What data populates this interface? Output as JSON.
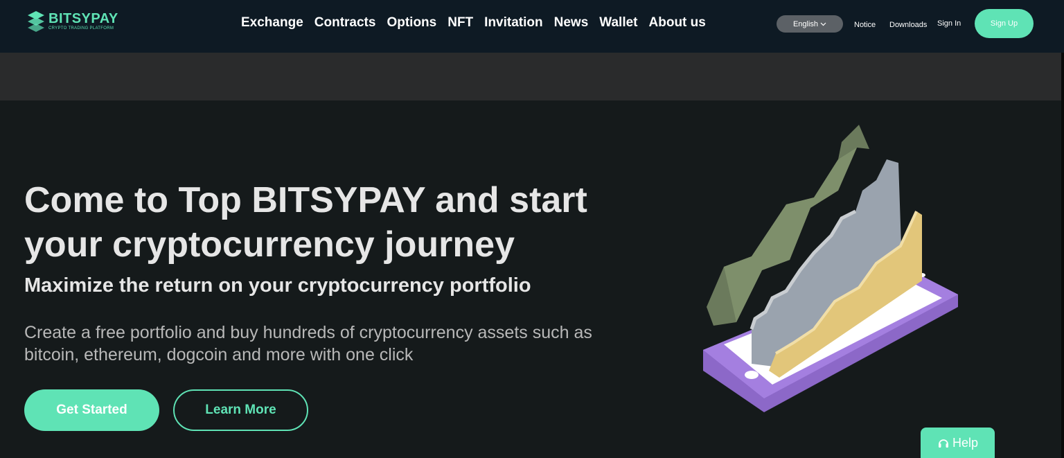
{
  "brand": {
    "name": "BITSYPAY",
    "tagline": "CRYPTO TRADING PLATFORM",
    "accent_color": "#5fe3b5"
  },
  "nav": {
    "items": [
      {
        "label": "Exchange"
      },
      {
        "label": "Contracts"
      },
      {
        "label": "Options"
      },
      {
        "label": "NFT"
      },
      {
        "label": "Invitation"
      },
      {
        "label": "News"
      },
      {
        "label": "Wallet"
      },
      {
        "label": "About us"
      }
    ]
  },
  "header_right": {
    "language": "English",
    "notice": "Notice",
    "downloads": "Downloads",
    "sign_in": "Sign In",
    "sign_up": "Sign Up"
  },
  "hero": {
    "title": "Come to Top BITSYPAY and start your cryptocurrency journey",
    "subtitle": "Maximize the return on your cryptocurrency portfolio",
    "description": "Create a free portfolio and buy hundreds of cryptocurrency assets such as bitcoin, ethereum, dogcoin and more with one click",
    "primary_button": "Get Started",
    "secondary_button": "Learn More",
    "illustration_icon": "phone-growth-chart-illustration"
  },
  "help": {
    "label": "Help",
    "icon": "headset-icon"
  }
}
